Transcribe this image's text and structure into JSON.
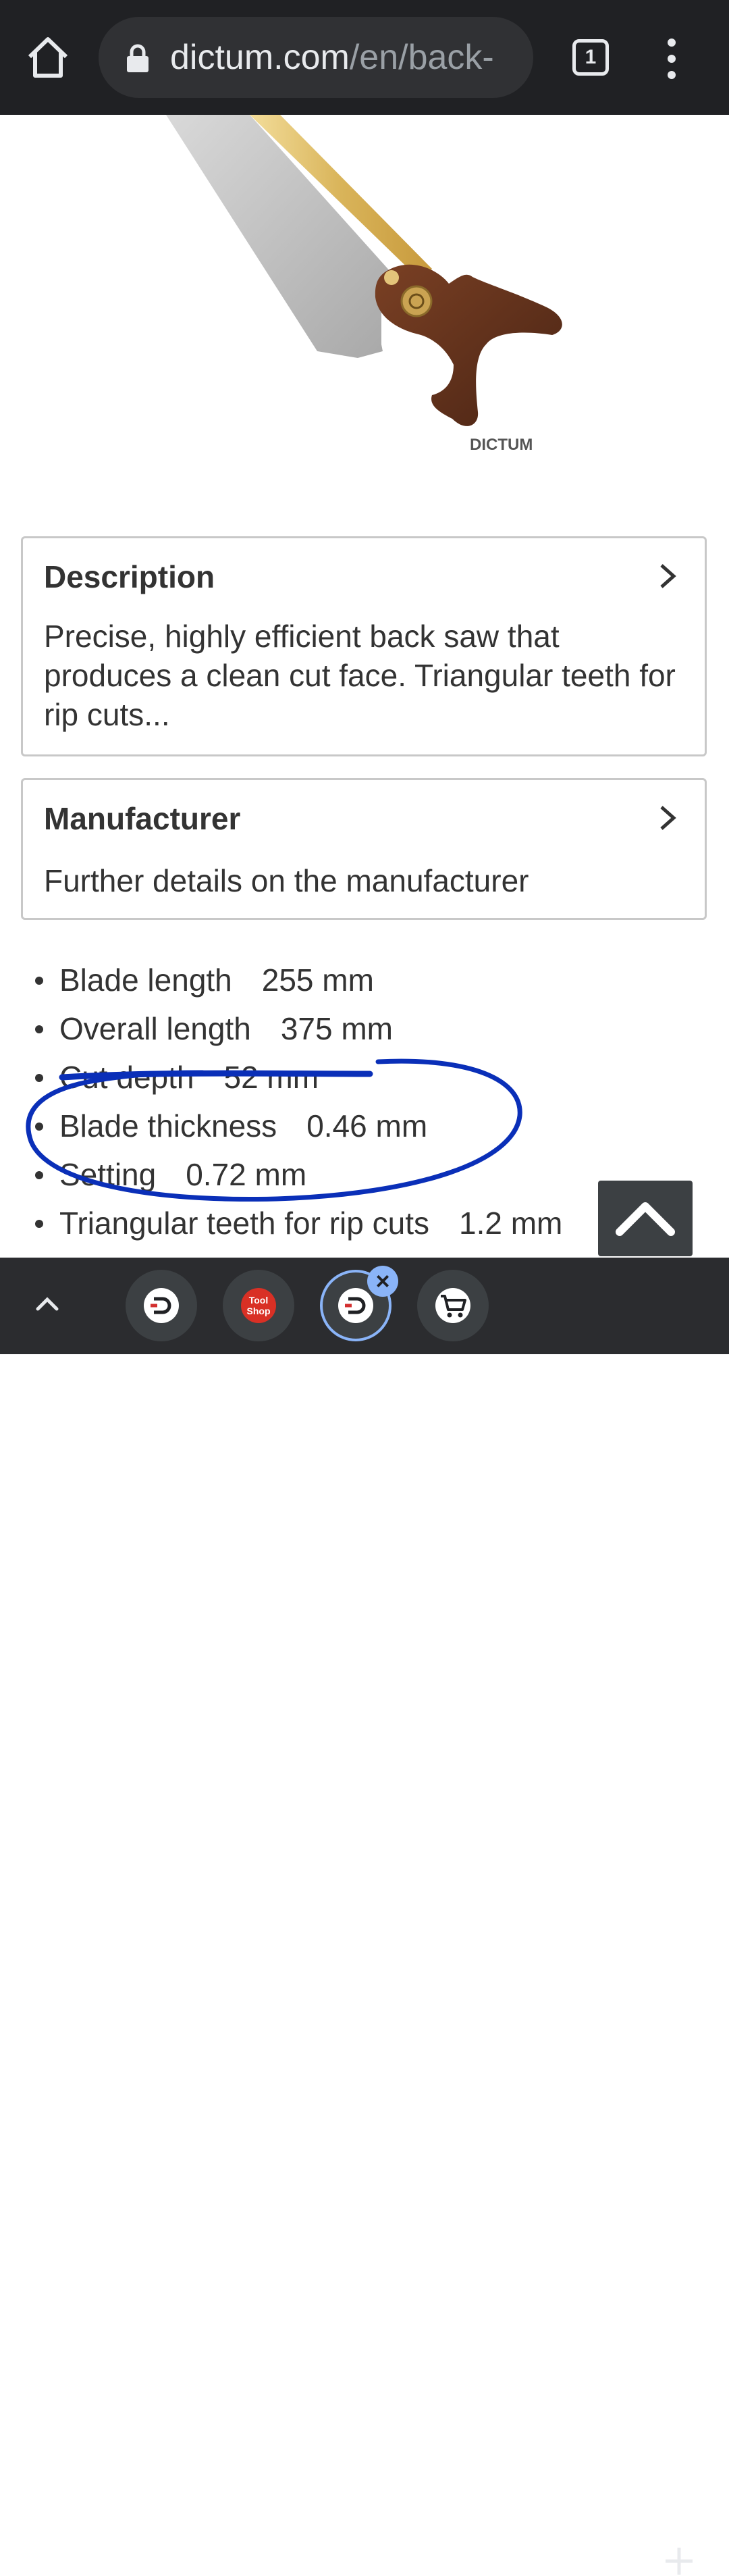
{
  "browser": {
    "url_domain": "dictum.com",
    "url_path": "/en/back-",
    "tab_count": "1",
    "icons": {
      "home": "home-icon",
      "lock": "lock-icon",
      "menu": "more-vert-icon"
    }
  },
  "product_image": {
    "brand_watermark": "DICTUM"
  },
  "description_card": {
    "title": "Description",
    "text": "Precise, highly efficient back saw that produces a clean cut face. Triangular teeth for rip cuts..."
  },
  "manufacturer_card": {
    "title": "Manufacturer",
    "text": "Further details on the manufacturer"
  },
  "specs": [
    {
      "label": "Blade length",
      "value": "255 mm"
    },
    {
      "label": "Overall length",
      "value": "375 mm"
    },
    {
      "label": "Cut depth",
      "value": "52 mm"
    },
    {
      "label": "Blade thickness",
      "value": "0.46 mm"
    },
    {
      "label": "Setting",
      "value": "0.72 mm"
    },
    {
      "label": "Triangular teeth for rip cuts",
      "value": "1.2 mm"
    }
  ],
  "annotation_color": "#0a2fb8",
  "bottom_tabs": [
    {
      "name": "dictum-tab",
      "icon": "dictum-logo-icon",
      "active": false
    },
    {
      "name": "toolshop-tab",
      "icon": "toolshop-logo-icon",
      "label": "Tool Shop",
      "active": false
    },
    {
      "name": "dictum-tab-active",
      "icon": "dictum-logo-icon",
      "active": true
    },
    {
      "name": "cart-tab",
      "icon": "cart-icon",
      "active": false
    }
  ]
}
